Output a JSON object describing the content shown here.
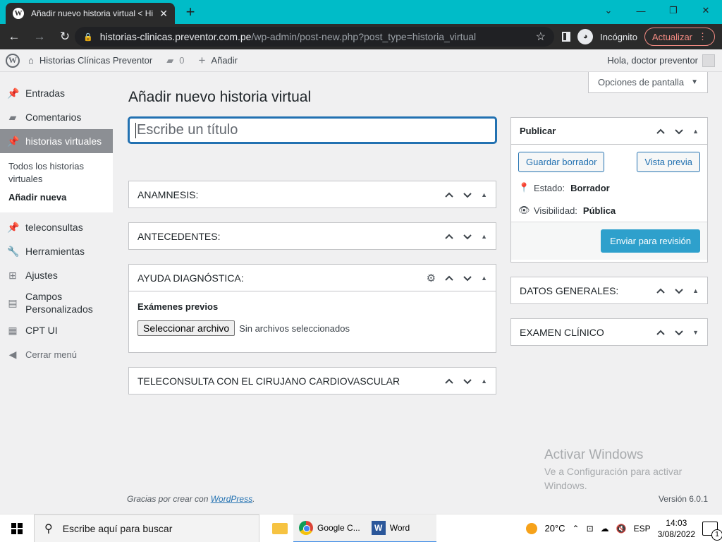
{
  "browser": {
    "tab_title": "Añadir nuevo historia virtual < Hi",
    "url_host": "historias-clinicas.preventor.com.pe",
    "url_path": "/wp-admin/post-new.php?post_type=historia_virtual",
    "incognito_label": "Incógnito",
    "update_label": "Actualizar"
  },
  "adminbar": {
    "site_name": "Historias Clínicas Preventor",
    "comments_count": "0",
    "new_label": "Añadir",
    "greeting": "Hola, doctor preventor"
  },
  "sidebar": {
    "items": [
      {
        "label": "Entradas",
        "icon": "pin-icon"
      },
      {
        "label": "Comentarios",
        "icon": "comment-icon"
      },
      {
        "label": "historias virtuales",
        "icon": "pin-icon"
      },
      {
        "label": "teleconsultas",
        "icon": "pin-icon"
      },
      {
        "label": "Herramientas",
        "icon": "wrench-icon"
      },
      {
        "label": "Ajustes",
        "icon": "settings-icon"
      },
      {
        "label": "Campos Personalizados",
        "icon": "table-icon"
      },
      {
        "label": "CPT UI",
        "icon": "grid-icon"
      },
      {
        "label": "Cerrar menú",
        "icon": "collapse-icon"
      }
    ],
    "submenu": {
      "all": "Todos los historias virtuales",
      "add_new": "Añadir nueva"
    }
  },
  "main": {
    "page_title": "Añadir nuevo historia virtual",
    "screen_options": "Opciones de pantalla",
    "title_placeholder": "Escribe un título",
    "boxes": {
      "anamnesis": "ANAMNESIS:",
      "antecedentes": "ANTECEDENTES:",
      "ayuda": "AYUDA DIAGNÓSTICA:",
      "teleconsulta": "TELECONSULTA CON EL CIRUJANO CARDIOVASCULAR"
    },
    "ayuda_field_label": "Exámenes previos",
    "file_button": "Seleccionar archivo",
    "file_status": "Sin archivos seleccionados"
  },
  "publish": {
    "title": "Publicar",
    "save_draft": "Guardar borrador",
    "preview": "Vista previa",
    "status_label": "Estado:",
    "status_value": "Borrador",
    "visibility_label": "Visibilidad:",
    "visibility_value": "Pública",
    "submit": "Enviar para revisión"
  },
  "side_boxes": {
    "datos": "DATOS GENERALES:",
    "examen": "EXAMEN CLÍNICO"
  },
  "footer": {
    "thanks_prefix": "Gracias por crear con ",
    "thanks_link": "WordPress",
    "thanks_suffix": ".",
    "version": "Versión 6.0.1"
  },
  "watermark": {
    "line1": "Activar Windows",
    "line2": "Ve a Configuración para activar Windows."
  },
  "taskbar": {
    "search_placeholder": "Escribe aquí para buscar",
    "chrome_label": "Google C...",
    "word_label": "Word",
    "temperature": "20°C",
    "language": "ESP",
    "time": "14:03",
    "date": "3/08/2022",
    "notifications": "1"
  },
  "colors": {
    "accent": "#2271b1",
    "primary_button": "#2ea0cc",
    "tabstrip": "#00bcc8"
  }
}
